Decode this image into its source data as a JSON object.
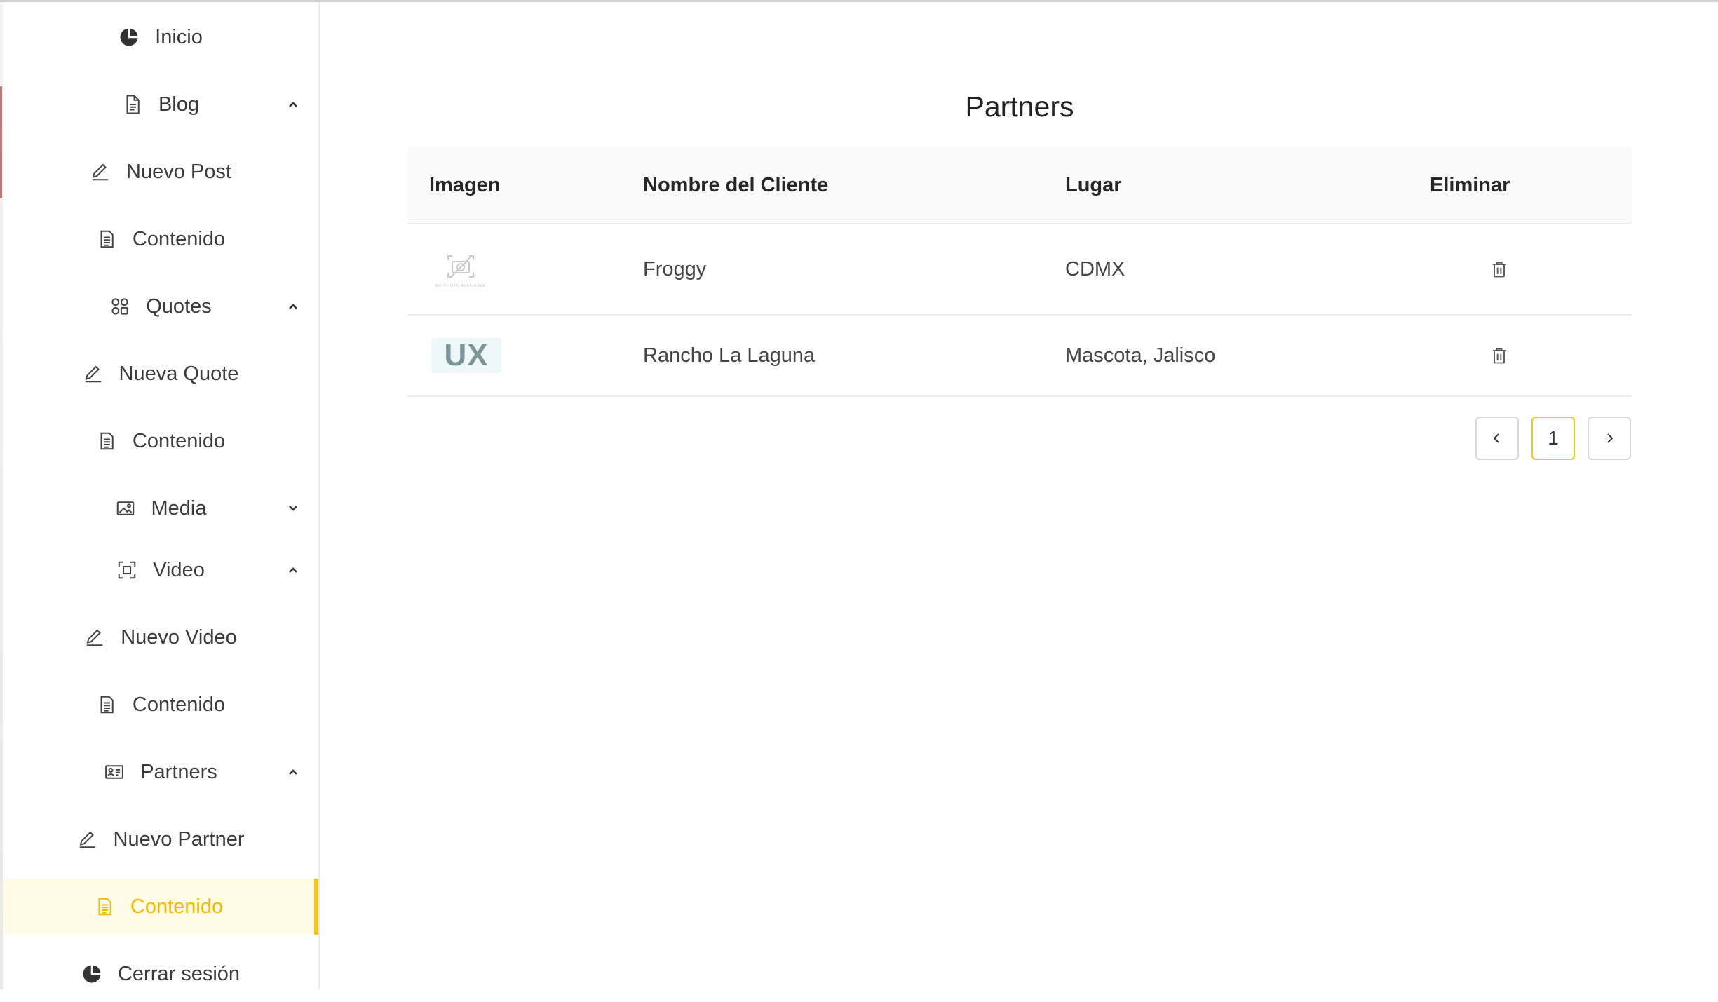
{
  "colors": {
    "accent": "#f5c518",
    "active_text": "#f5b800",
    "active_bg": "#fffbe6"
  },
  "sidebar": {
    "items": [
      {
        "label": "Inicio",
        "icon": "pie-chart-icon"
      },
      {
        "label": "Blog",
        "icon": "file-text-icon",
        "chevron": "up"
      },
      {
        "label": "Nuevo Post",
        "icon": "pencil-icon"
      },
      {
        "label": "Contenido",
        "icon": "document-icon"
      },
      {
        "label": "Quotes",
        "icon": "apps-icon",
        "chevron": "up"
      },
      {
        "label": "Nueva Quote",
        "icon": "pencil-icon"
      },
      {
        "label": "Contenido",
        "icon": "document-icon"
      },
      {
        "label": "Media",
        "icon": "picture-icon",
        "chevron": "down"
      },
      {
        "label": "Video",
        "icon": "scan-icon",
        "chevron": "up"
      },
      {
        "label": "Nuevo Video",
        "icon": "pencil-icon"
      },
      {
        "label": "Contenido",
        "icon": "document-icon"
      },
      {
        "label": "Partners",
        "icon": "id-card-icon",
        "chevron": "up"
      },
      {
        "label": "Nuevo Partner",
        "icon": "pencil-icon"
      },
      {
        "label": "Contenido",
        "icon": "document-icon",
        "active": true
      },
      {
        "label": "Cerrar sesión",
        "icon": "pie-chart-icon"
      }
    ]
  },
  "main": {
    "title": "Partners",
    "table": {
      "headers": [
        "Imagen",
        "Nombre del Cliente",
        "Lugar",
        "Eliminar"
      ],
      "rows": [
        {
          "image": "no-photo-available",
          "image_text": "NO PHOTO AVAILABLE",
          "name": "Froggy",
          "place": "CDMX"
        },
        {
          "image": "ux-logo",
          "image_text": "UX",
          "name": "Rancho La Laguna",
          "place": "Mascota, Jalisco"
        }
      ]
    },
    "pagination": {
      "current_page": "1"
    }
  }
}
